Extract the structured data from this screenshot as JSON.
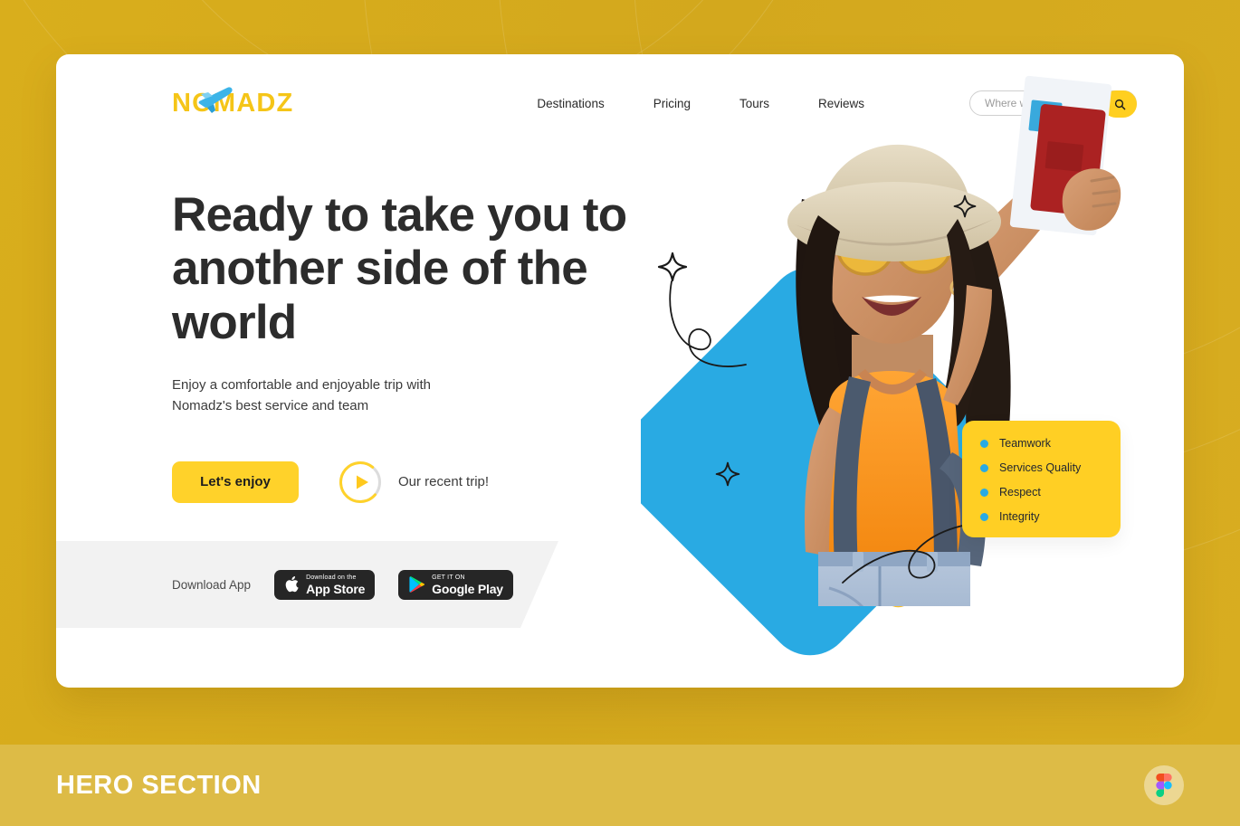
{
  "background": {
    "top_color": "#d5ab1f",
    "footer_color": "#ddbb46"
  },
  "header": {
    "logo_text": "NOMADZ",
    "logo_icon": "airplane-icon",
    "logo_color": "#f5c518",
    "nav": [
      {
        "label": "Destinations"
      },
      {
        "label": "Pricing"
      },
      {
        "label": "Tours"
      },
      {
        "label": "Reviews"
      }
    ],
    "search": {
      "placeholder": "Where we go now...",
      "value": "",
      "button_icon": "search-icon",
      "button_color": "#ffcf20"
    }
  },
  "hero": {
    "headline": "Ready to take you to another side of the world",
    "subheadline": "Enjoy a comfortable and enjoyable trip with Nomadz's best service and team",
    "cta_label": "Let's enjoy",
    "cta_color": "#ffd22a",
    "play_icon": "play-icon",
    "video_label": "Our recent trip!"
  },
  "download": {
    "label": "Download App",
    "app_store": {
      "icon": "apple-icon",
      "small_text": "Download on the",
      "big_text": "App Store"
    },
    "google_play": {
      "icon": "google-play-icon",
      "small_text": "GET IT ON",
      "big_text": "Google Play"
    }
  },
  "values_card": {
    "accent_color": "#ffcf24",
    "bullet_color": "#29aae3",
    "items": [
      {
        "label": "Teamwork"
      },
      {
        "label": "Services Quality"
      },
      {
        "label": "Respect"
      },
      {
        "label": "Integrity"
      }
    ]
  },
  "artwork": {
    "blue_shape_color": "#29aae3",
    "yellow_shape_color": "#fbbf24",
    "subject": "smiling-woman-with-hat-sunglasses-backpack-holding-passport",
    "sparkle_count": 4,
    "doodle_count": 2
  },
  "footer": {
    "title": "HERO SECTION",
    "badge_icon": "figma-icon"
  }
}
